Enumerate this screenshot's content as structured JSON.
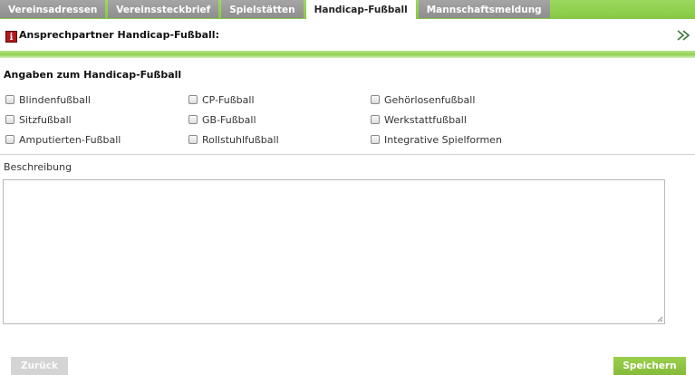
{
  "tabs": [
    {
      "label": "Vereinsadressen"
    },
    {
      "label": "Vereinssteckbrief"
    },
    {
      "label": "Spielstätten"
    },
    {
      "label": "Handicap-Fußball"
    },
    {
      "label": "Mannschaftsmeldung"
    }
  ],
  "active_tab": "Handicap-Fußball",
  "contact": {
    "info_icon_char": "i",
    "title": "Ansprechpartner Handicap-Fußball:"
  },
  "section": {
    "title": "Angaben zum Handicap-Fußball",
    "options": [
      {
        "label": "Blindenfußball",
        "checked": false
      },
      {
        "label": "CP-Fußball",
        "checked": false
      },
      {
        "label": "Gehörlosenfußball",
        "checked": false
      },
      {
        "label": "Sitzfußball",
        "checked": false
      },
      {
        "label": "GB-Fußball",
        "checked": false
      },
      {
        "label": "Werkstattfußball",
        "checked": false
      },
      {
        "label": "Amputierten-Fußball",
        "checked": false
      },
      {
        "label": "Rollstuhlfußball",
        "checked": false
      },
      {
        "label": "Integrative Spielformen",
        "checked": false
      }
    ]
  },
  "description": {
    "label": "Beschreibung",
    "value": ""
  },
  "buttons": {
    "back": "Zurück",
    "save": "Speichern"
  },
  "colors": {
    "accent_green": "#8fd04f",
    "inactive_tab": "#9a9a9a",
    "info_red": "#b01a1a"
  }
}
